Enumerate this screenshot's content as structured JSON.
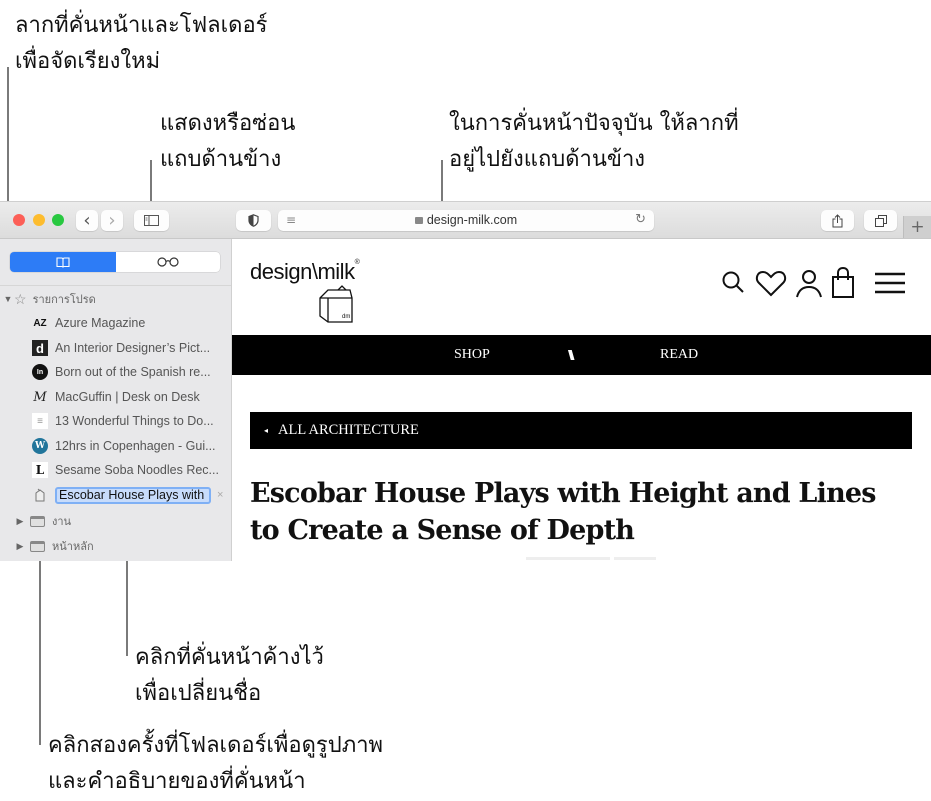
{
  "callouts": {
    "drag_reorder": [
      "ลากที่คั่นหน้าและโฟลเดอร์",
      "เพื่อจัดเรียงใหม่"
    ],
    "show_hide_sidebar": [
      "แสดงหรือซ่อน",
      "แถบด้านข้าง"
    ],
    "drag_current": [
      "ในการคั่นหน้าปัจจุบัน ให้ลากที่",
      "อยู่ไปยังแถบด้านข้าง"
    ],
    "rename": [
      "คลิกที่คั่นหน้าค้างไว้",
      "เพื่อเปลี่ยนชื่อ"
    ],
    "double_click_folder": [
      "คลิกสองครั้งที่โฟลเดอร์เพื่อดูรูปภาพ",
      "และคำอธิบายของที่คั่นหน้า"
    ]
  },
  "toolbar": {
    "back_icon": "‹",
    "forward_icon": "›",
    "sidebar_icon": "sidebar-icon",
    "privacy_icon": "◐",
    "reader_icon": "≡",
    "lock_icon": "🔒",
    "url": "design-milk.com",
    "reload_icon": "↻",
    "share_icon": "share-icon",
    "tabs_icon": "tabs-icon",
    "new_tab_label": "+"
  },
  "sidebar": {
    "tab_bookmarks_icon": "book-icon",
    "tab_reading_list_icon": "glasses-icon",
    "favorites_label": "รายการโปรด",
    "bookmarks": [
      {
        "icon_text": "AZ",
        "title": "Azure Magazine"
      },
      {
        "icon_text": "d",
        "title": "An Interior Designer’s Pict..."
      },
      {
        "icon_text": "In",
        "title": "Born out of the Spanish re..."
      },
      {
        "icon_text": "M",
        "title": "MacGuffin | Desk on Desk"
      },
      {
        "icon_text": "≡",
        "title": "13 Wonderful Things to Do..."
      },
      {
        "icon_text": "W",
        "title": "12hrs in Copenhagen - Gui..."
      },
      {
        "icon_text": "L",
        "title": "Sesame Soba Noodles Rec..."
      }
    ],
    "editing_bookmark": {
      "value": "Escobar House Plays with H",
      "clear_icon": "×"
    },
    "folders": [
      {
        "label": "งาน"
      },
      {
        "label": "หน้าหลัก"
      }
    ]
  },
  "site": {
    "logo_text_left": "design",
    "logo_text_right": "milk",
    "logo_mark": "®",
    "carton_label": "dm",
    "nav": {
      "shop": "SHOP",
      "divider": "\\\\\\\\",
      "read": "READ"
    },
    "breadcrumb_arrow": "◂",
    "breadcrumb": "ALL ARCHITECTURE",
    "headline_line1": "Escobar House Plays with Height and Lines",
    "headline_line2": "to Create a Sense of Depth"
  }
}
